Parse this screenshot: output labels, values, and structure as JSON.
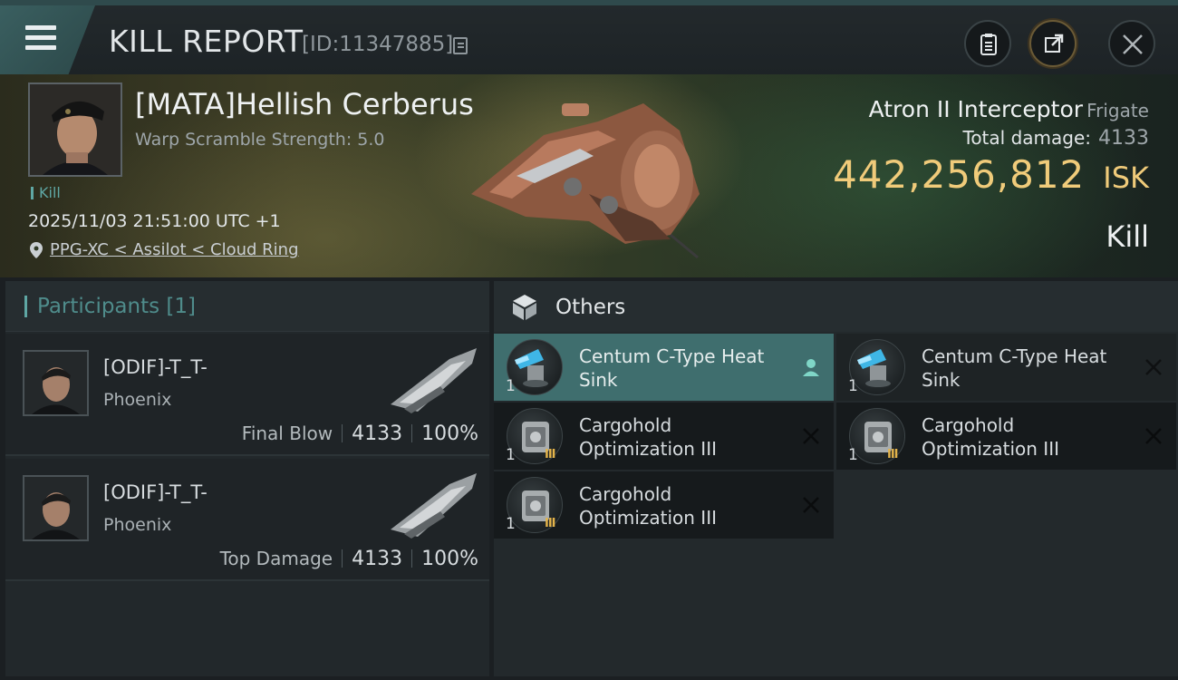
{
  "header": {
    "title": "KILL REPORT",
    "report_id": "[ID:11347885]"
  },
  "victim": {
    "name": "[MATA]Hellish Cerberus",
    "warp_scramble": "Warp Scramble Strength: 5.0",
    "tag": "Kill",
    "datetime": "2025/11/03 21:51:00 UTC +1",
    "location": "PPG-XC < Assilot < Cloud Ring"
  },
  "ship": {
    "name": "Atron II Interceptor",
    "class": "Frigate",
    "total_damage_label": "Total damage:",
    "total_damage": "4133",
    "isk_value": "442,256,812",
    "isk_unit": "ISK",
    "result": "Kill"
  },
  "participants": {
    "title": "Participants [1]",
    "items": [
      {
        "name": "[ODIF]-T_T-",
        "ship": "Phoenix",
        "role": "Final Blow",
        "damage": "4133",
        "percent": "100%"
      },
      {
        "name": "[ODIF]-T_T-",
        "ship": "Phoenix",
        "role": "Top Damage",
        "damage": "4133",
        "percent": "100%"
      }
    ]
  },
  "others": {
    "title": "Others",
    "items": [
      {
        "name": "Centum C-Type Heat Sink",
        "qty": "1",
        "icon": "heat-sink-icon",
        "status": "person-icon",
        "selected": true
      },
      {
        "name": "Centum C-Type Heat Sink",
        "qty": "1",
        "icon": "heat-sink-icon",
        "status": "destroyed-x-icon",
        "selected": false
      },
      {
        "name": "Cargohold Optimization III",
        "qty": "1",
        "icon": "cargohold-rig-icon",
        "tier": "III",
        "status": "destroyed-x-icon",
        "selected": false
      },
      {
        "name": "Cargohold Optimization III",
        "qty": "1",
        "icon": "cargohold-rig-icon",
        "tier": "III",
        "status": "destroyed-x-icon",
        "selected": false
      },
      {
        "name": "Cargohold Optimization III",
        "qty": "1",
        "icon": "cargohold-rig-icon",
        "tier": "III",
        "status": "destroyed-x-icon",
        "selected": false
      }
    ]
  },
  "colors": {
    "accent_teal": "#5fa7a4",
    "isk_gold": "#f0cb7a",
    "selected_row": "#3f6e6e"
  }
}
